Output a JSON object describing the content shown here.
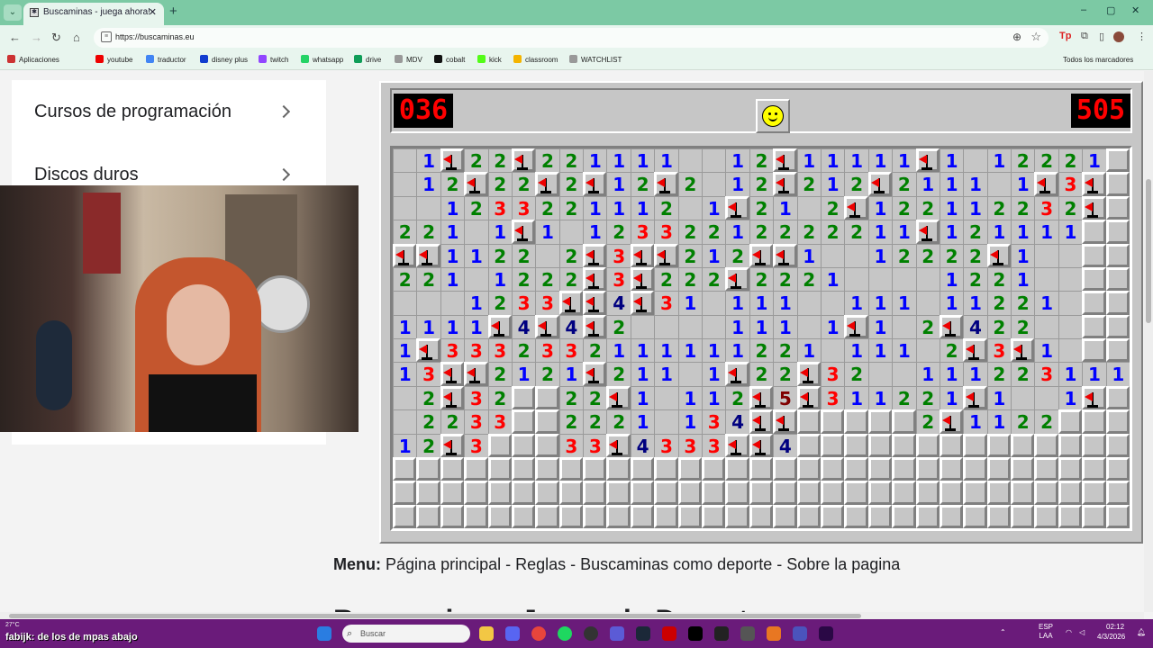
{
  "browser": {
    "tab_title": "Buscaminas - juega ahora!",
    "url": "https://buscaminas.eu",
    "new_tab": "+",
    "win_min": "–",
    "win_max": "▢",
    "win_close": "✕"
  },
  "bookmarks": [
    {
      "label": "Aplicaciones",
      "color": "#c33"
    },
    {
      "label": "youtube",
      "color": "#e00"
    },
    {
      "label": "traductor",
      "color": "#4285f4"
    },
    {
      "label": "disney plus",
      "color": "#113ccf"
    },
    {
      "label": "twitch",
      "color": "#9146ff"
    },
    {
      "label": "whatsapp",
      "color": "#25d366"
    },
    {
      "label": "drive",
      "color": "#0f9d58"
    },
    {
      "label": "MDV",
      "color": "#999"
    },
    {
      "label": "cobalt",
      "color": "#111"
    },
    {
      "label": "kick",
      "color": "#53fc18"
    },
    {
      "label": "classroom",
      "color": "#f4b400"
    },
    {
      "label": "WATCHLIST",
      "color": "#999"
    }
  ],
  "bookmarks_all": "Todos los marcadores",
  "sidemenu": [
    {
      "label": "Cursos de programación"
    },
    {
      "label": "Discos duros"
    }
  ],
  "game": {
    "mine_counter": "036",
    "timer": "505",
    "rows": [
      "_1F22F221111__12F11111F1_12221",
      "_12F22F2F12F2_12F212F2111_1F3F",
      "__1233221112_1F21_2F122112232F",
      "221_1F1_12332212222211F121111",
      "FF1122_2F3FF212FF1__12222F1__",
      "221_1222F3F222F2221____1221__",
      "___1233FF4F31_111__111_11221_",
      "1111F4F4F2____111_1F1_2F422__",
      "1F3332332111111221_111_2F3F1_",
      "13FF2121F211_1F22F32__1112231111",
      "_2F32##22F1_112F5F311221F1__1F",
      "_2233##2221_134FF#####2F1122",
      "12F3###33F4333FF4###########",
      "##############################",
      "##############################",
      "##############################"
    ]
  },
  "menu": {
    "prefix": "Menu:",
    "items": "Página principal - Reglas - Buscaminas como deporte - Sobre la pagina"
  },
  "heading": "Buscaminas: Juego de Deporte",
  "taskbar": {
    "weather": "27°C",
    "caption": "fabijk: de los de mpas abajo",
    "search_placeholder": "Buscar",
    "lang": "ESP LAA",
    "time": "02:12",
    "date": "4/3/2026"
  }
}
